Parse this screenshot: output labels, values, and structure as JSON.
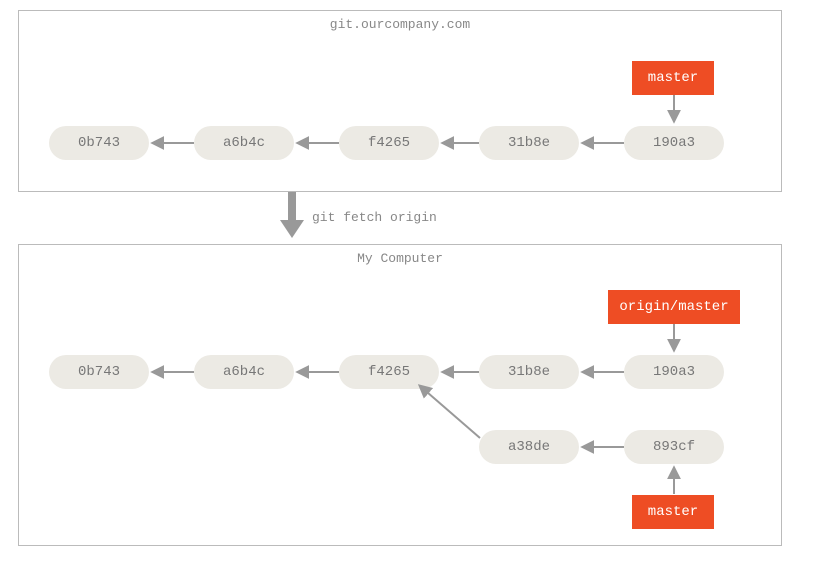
{
  "remote": {
    "title": "git.ourcompany.com",
    "commits": [
      "0b743",
      "a6b4c",
      "f4265",
      "31b8e",
      "190a3"
    ],
    "ref": "master"
  },
  "fetch_command": "git fetch origin",
  "local": {
    "title": "My Computer",
    "top_commits": [
      "0b743",
      "a6b4c",
      "f4265",
      "31b8e",
      "190a3"
    ],
    "bottom_commits": [
      "a38de",
      "893cf"
    ],
    "origin_ref": "origin/master",
    "master_ref": "master"
  }
}
